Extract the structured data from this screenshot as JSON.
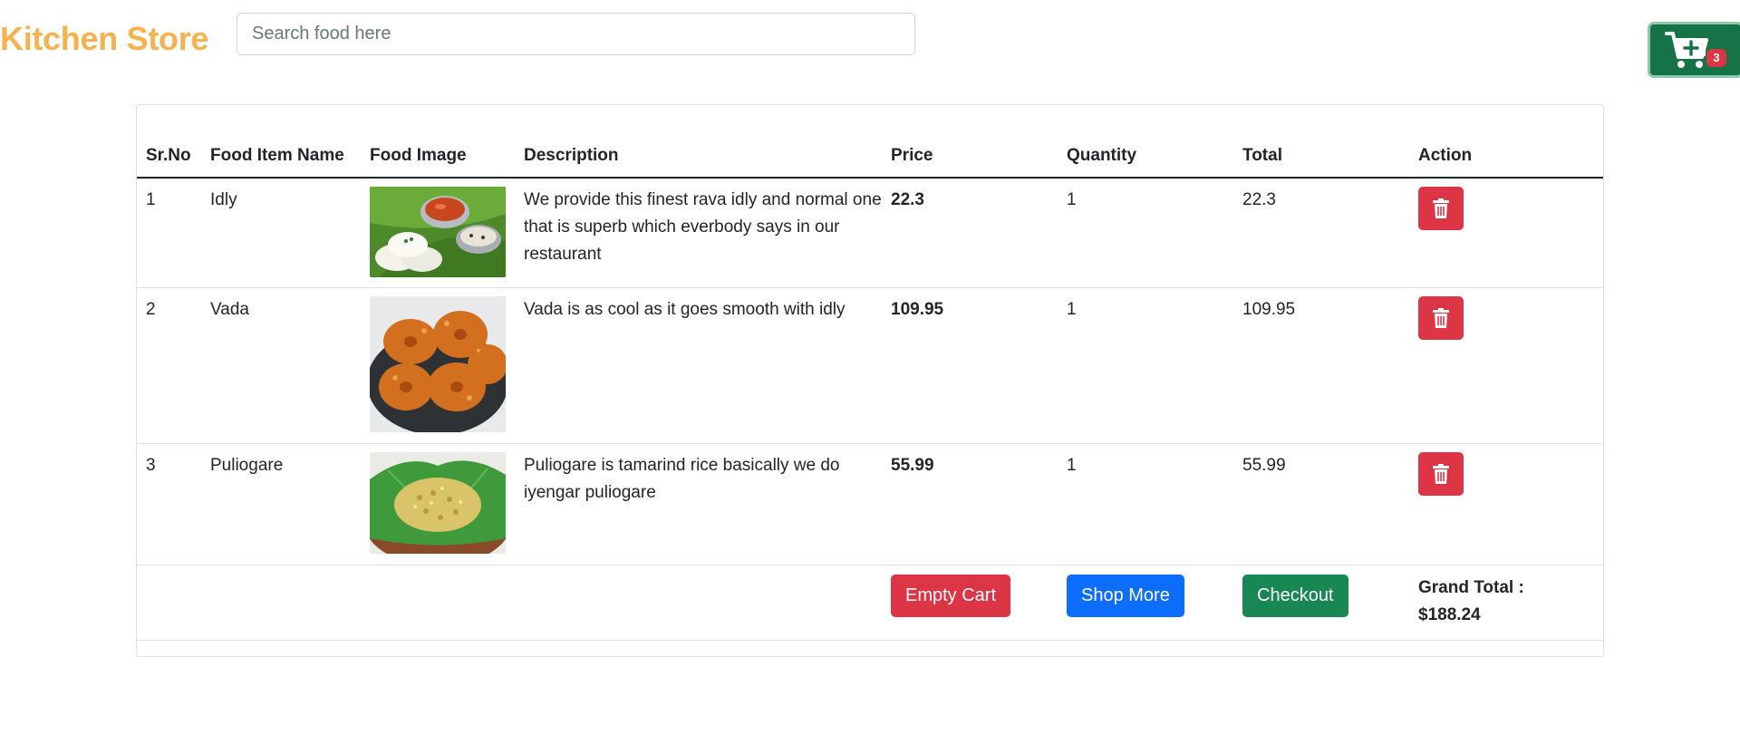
{
  "brand": "Kitchen Store",
  "search": {
    "placeholder": "Search food here"
  },
  "cart": {
    "icon": "cart-plus-icon",
    "count": "3"
  },
  "table": {
    "headers": [
      "Sr.No",
      "Food Item Name",
      "Food Image",
      "Description",
      "Price",
      "Quantity",
      "Total",
      "Action"
    ],
    "rows": [
      {
        "sr": "1",
        "name": "Idly",
        "image": "idly-image",
        "description": "We provide this finest rava idly and normal one that is superb which everbody says in our restaurant",
        "price": "22.3",
        "quantity": "1",
        "total": "22.3"
      },
      {
        "sr": "2",
        "name": "Vada",
        "image": "vada-image",
        "description": "Vada is as cool as it goes smooth with idly",
        "price": "109.95",
        "quantity": "1",
        "total": "109.95"
      },
      {
        "sr": "3",
        "name": "Puliogare",
        "image": "puliogare-image",
        "description": "Puliogare is tamarind rice basically we do iyengar puliogare",
        "price": "55.99",
        "quantity": "1",
        "total": "55.99"
      }
    ]
  },
  "footer": {
    "empty_cart": "Empty Cart",
    "shop_more": "Shop More",
    "checkout": "Checkout",
    "grand_total_label": "Grand Total :",
    "grand_total_value": "$188.24"
  },
  "colors": {
    "brand": "#f7b250",
    "danger": "#dc3545",
    "primary": "#0d6efd",
    "success": "#198754",
    "cart": "#157347"
  }
}
